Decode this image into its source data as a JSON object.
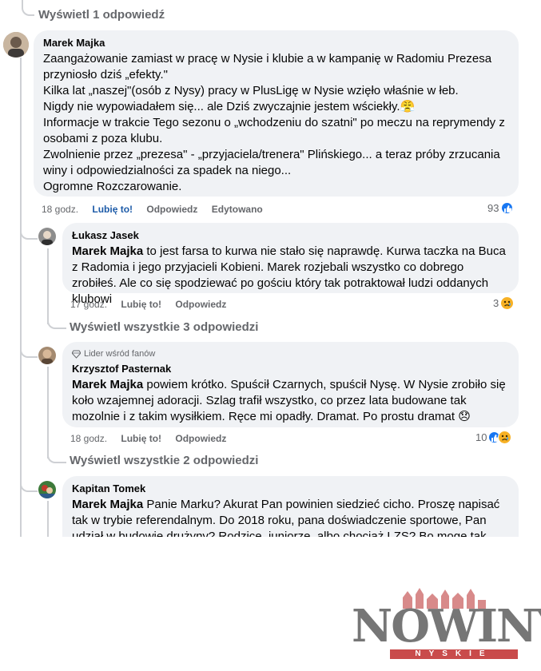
{
  "top_view_more": "Wyświetl 1 odpowiedź",
  "comments": [
    {
      "author": "Marek Majka",
      "lines": [
        "Zaangażowanie zamiast w pracę w Nysie i klubie a w kampanię w Radomiu Prezesa przyniosło dziś „efekty.\"",
        "Kilka lat „naszej\"(osób z Nysy) pracy w PlusLigę w Nysie wzięło właśnie w łeb.",
        "Nigdy nie wypowiadałem się... ale Dziś zwyczajnie jestem wściekły.😤",
        "Informacje w trakcie Tego sezonu o „wchodzeniu do szatni\" po meczu na reprymendy z osobami z poza klubu.",
        "Zwolnienie przez „prezesa\" - „przyjaciela/trenera\" Plińskiego... a teraz próby zrzucania winy i odpowiedzialności za spadek na niego...",
        "Ogromne Rozczarowanie."
      ],
      "time": "18 godz.",
      "like": "Lubię to!",
      "reply": "Odpowiedz",
      "edited": "Edytowano",
      "reaction_count": "93"
    },
    {
      "author": "Łukasz Jasek",
      "mention": "Marek Majka",
      "text": " to jest farsa to kurwa nie stało się naprawdę. Kurwa taczka na Buca z Radomia i jego przyjacieli Kobieni. Marek rozjebali wszystko co dobrego zrobiłeś. Ale co się spodziewać po gościu który tak potraktował ludzi oddanych klubowi",
      "time": "17 godz.",
      "like": "Lubię to!",
      "reply": "Odpowiedz",
      "reaction_count": "3",
      "view_more": "Wyświetl wszystkie 3 odpowiedzi"
    },
    {
      "badge": "Lider wśród fanów",
      "author": "Krzysztof Pasternak",
      "mention": "Marek Majka",
      "text": " powiem krótko. Spuścił Czarnych, spuścił Nysę. W Nysie zrobiło się koło wzajemnej adoracji. Szlag trafił wszystko, co przez lata budowane tak mozolnie i z takim wysiłkiem. Ręce mi opadły. Dramat. Po prostu dramat 😞",
      "time": "18 godz.",
      "like": "Lubię to!",
      "reply": "Odpowiedz",
      "reaction_count": "10",
      "view_more": "Wyświetl wszystkie 2 odpowiedzi"
    },
    {
      "author": "Kapitan Tomek",
      "mention": "Marek Majka",
      "text": " Panie Marku? Akurat Pan powinien siedzieć cicho. Proszę napisać tak w trybie referendalnym. Do 2018 roku, pana doświadczenie sportowe, Pan udział w budowie drużyny? Rodzice, juniorze, albo chociaż LZS? Bo moge tak długo"
    }
  ],
  "logo": {
    "word": "NOWINY",
    "sub": "NYSKIE"
  },
  "colors": {
    "bubble": "#f0f2f5",
    "link": "#1d5ba8",
    "like": "#1877f2",
    "logo_red": "#c94b4b"
  }
}
